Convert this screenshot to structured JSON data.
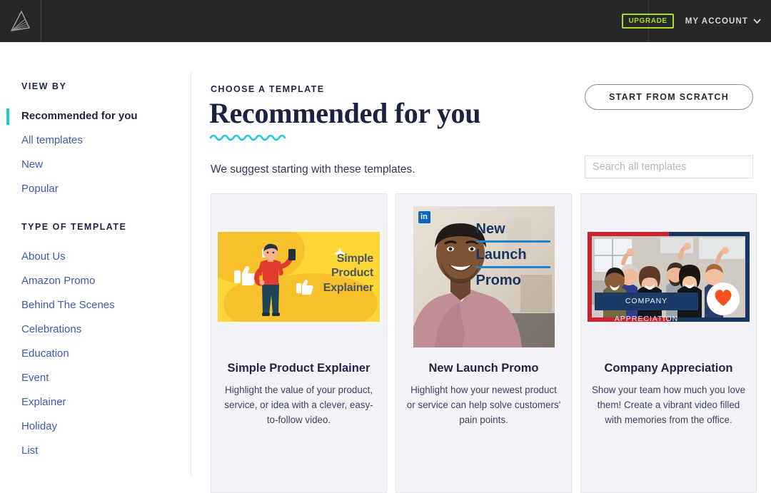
{
  "topbar": {
    "logo_name": "animoto-logo",
    "upgrade_label": "UPGRADE",
    "account_label": "MY ACCOUNT",
    "chevron_icon": "chevron-down-icon",
    "bg_color": "#272727",
    "upgrade_color": "#a6e022"
  },
  "sidebar": {
    "view_by_heading": "VIEW BY",
    "view_by_items": [
      {
        "label": "Recommended for you",
        "active": true
      },
      {
        "label": "All templates",
        "active": false
      },
      {
        "label": "New",
        "active": false
      },
      {
        "label": "Popular",
        "active": false
      }
    ],
    "type_heading": "TYPE OF TEMPLATE",
    "type_items": [
      {
        "label": "About Us"
      },
      {
        "label": "Amazon Promo"
      },
      {
        "label": "Behind The Scenes"
      },
      {
        "label": "Celebrations"
      },
      {
        "label": "Education"
      },
      {
        "label": "Event"
      },
      {
        "label": "Explainer"
      },
      {
        "label": "Holiday"
      },
      {
        "label": "List"
      }
    ],
    "active_accent_color": "#1ecad3",
    "link_color": "#3f5ba9"
  },
  "main": {
    "eyebrow": "CHOOSE A TEMPLATE",
    "title": "Recommended for you",
    "subtitle": "We suggest starting with these templates.",
    "wave_color": "#1ecad3",
    "start_from_scratch_label": "START FROM SCRATCH",
    "search": {
      "placeholder": "Search all templates",
      "value": ""
    },
    "cards": [
      {
        "title": "Simple Product Explainer",
        "desc": "Highlight the value of your product, service, or idea with a clever, easy-to-follow video.",
        "thumb_kind": "yellow-explainer",
        "thumb_text": "Simple\nProduct\nExplainer",
        "thumb_bg": "#fcd736",
        "thumb_text_color": "#4c5361"
      },
      {
        "title": "New Launch Promo",
        "desc": "Highlight how your newest product or service can help solve customers' pain points.",
        "thumb_kind": "linkedin-portrait",
        "badge_icon": "linkedin-icon",
        "badge_label": "in",
        "thumb_lines": [
          "New",
          "Launch",
          "Promo"
        ],
        "thumb_text_color": "#16365f",
        "rule_color": "#1a85c9"
      },
      {
        "title": "Company Appreciation",
        "desc": "Show your team how much you love them! Create a vibrant video filled with memories from the office.",
        "thumb_kind": "team-photo",
        "banner_text": "COMPANY APPRECIATION",
        "frame_left_color": "#cf2230",
        "frame_right_color": "#17355e",
        "heart_icon": "heart-icon",
        "heart_color": "#f4511e"
      }
    ]
  }
}
